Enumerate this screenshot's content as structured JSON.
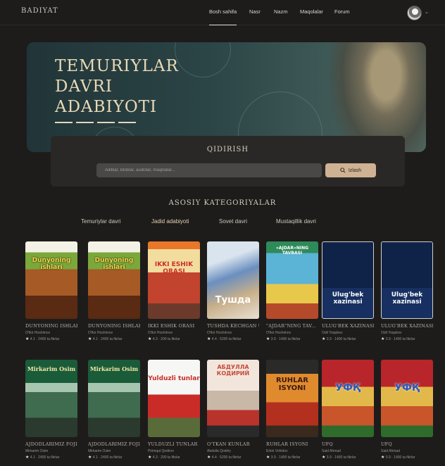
{
  "brand": {
    "logo": "BADIYAT"
  },
  "nav": {
    "links": [
      "Bosh sahifa",
      "Nasr",
      "Nazm",
      "Maqolalar",
      "Forum"
    ],
    "active_index": 0
  },
  "hero": {
    "title_lines": [
      "TEMURIYLAR",
      "DAVRI",
      "ADABIYOTI"
    ]
  },
  "search": {
    "title": "QIDIRISH",
    "placeholder": "Adiblar, kitoblar, audiolar, maqolalar...",
    "button_label": "Izlash"
  },
  "categories": {
    "title": "ASOSIY KATEGORIYALAR",
    "tabs": [
      "Temuriylar davri",
      "Jadid adabiyoti",
      "Sovet davri",
      "Mustaqillik davri"
    ],
    "active_index": 1
  },
  "books": [
    {
      "title": "DUNYONING ISHLARI",
      "author": "O'tkir Hoshimov",
      "rating": "4.1 · 2400 ta fikrlar",
      "cover_text": "Dunyoning ishlari",
      "style": "c-green"
    },
    {
      "title": "DUNYONING ISHLARI",
      "author": "O'tkir Hoshimov",
      "rating": "4.1 · 2400 ta fikrlar",
      "cover_text": "Dunyoning ishlari",
      "style": "c-green"
    },
    {
      "title": "IKKI ESHIK ORASI",
      "author": "O'tkir Hoshimov",
      "rating": "4.3 · 200 ta fikrlar",
      "cover_text": "IKKI ESHIK ORASI",
      "style": "c-orange"
    },
    {
      "title": "TUSHDA KECHGAN UMRLAR",
      "author": "O'tkir Hoshimov",
      "rating": "4.4 · 5200 ta fikrlar",
      "cover_text": "Тушда",
      "style": "c-blue"
    },
    {
      "title": "\"AJDAR\"NING TAV...",
      "author": "O'tkir Hoshimov",
      "rating": "3.9 · 1400 ta fikrlar",
      "cover_text": "«AJDAR»NING TAVBASI",
      "style": "c-cartoon"
    },
    {
      "title": "ULUG'BEK XAZINASI",
      "author": "Odil Yoqubov",
      "rating": "3.9 · 1400 ta fikrlar",
      "cover_text": "Ulug'bek xazinasi",
      "style": "c-navy"
    },
    {
      "title": "ULUG'BEK XAZINASI",
      "author": "Odil Yoqubov",
      "rating": "3.9 · 1400 ta fikrlar",
      "cover_text": "Ulug'bek xazinasi",
      "style": "c-navy"
    },
    {
      "title": "AJDODLARIMIZ FOJIA...",
      "author": "Mirkarim Osim",
      "rating": "4.1 · 2400 ta fikrlar",
      "cover_text": "Mirkarim Osim",
      "style": "c-darkgreen"
    },
    {
      "title": "AJDODLARIMIZ FOJIA...",
      "author": "Mirkarim Osim",
      "rating": "4.1 · 2400 ta fikrlar",
      "cover_text": "Mirkarim Osim",
      "style": "c-darkgreen"
    },
    {
      "title": "YULDUZLI TUNLAR",
      "author": "Pirimqul Qodirov",
      "rating": "4.3 · 200 ta fikrlar",
      "cover_text": "Yulduzli tunlar",
      "style": "c-white"
    },
    {
      "title": "O'TKAN KUNLAR",
      "author": "Abdulla Qodiriy",
      "rating": "4.4 · 5200 ta fikrlar",
      "cover_text": "АБДУЛЛА КОДИРИЙ",
      "style": "c-salmon"
    },
    {
      "title": "RUHLAR ISYONI",
      "author": "Erkin Vohidov",
      "rating": "3.9 · 1400 ta fikrlar",
      "cover_text": "RUHLAR ISYONI",
      "style": "c-ruhlar"
    },
    {
      "title": "UFQ",
      "author": "Said Ahmad",
      "rating": "3.9 · 1400 ta fikrlar",
      "cover_text": "УФҚ",
      "style": "c-ufq"
    },
    {
      "title": "UFQ",
      "author": "Said Ahmad",
      "rating": "3.9 · 1400 ta fikrlar",
      "cover_text": "УФҚ",
      "style": "c-ufq"
    }
  ]
}
